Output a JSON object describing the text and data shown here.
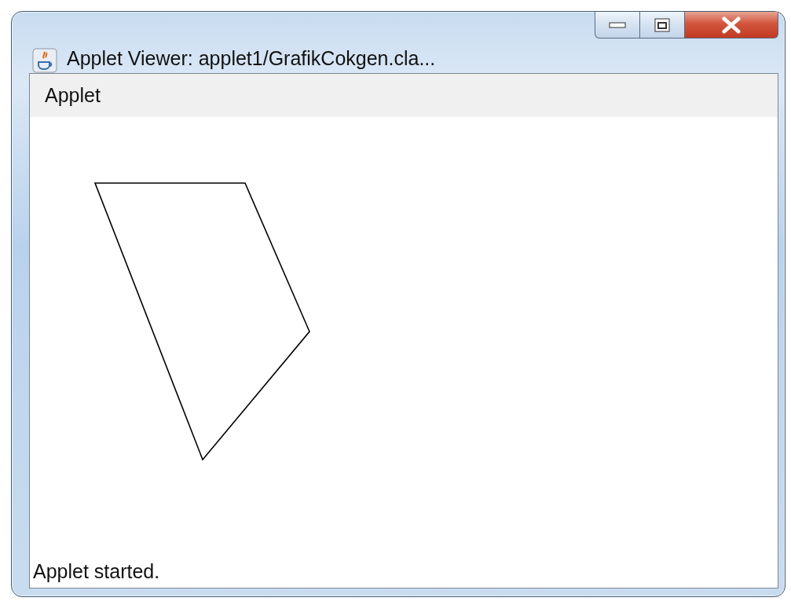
{
  "window": {
    "title": "Applet Viewer: applet1/GrafikCokgen.cla..."
  },
  "menu_bar": {
    "items": [
      "Applet"
    ]
  },
  "status_bar": {
    "text": "Applet started."
  }
}
